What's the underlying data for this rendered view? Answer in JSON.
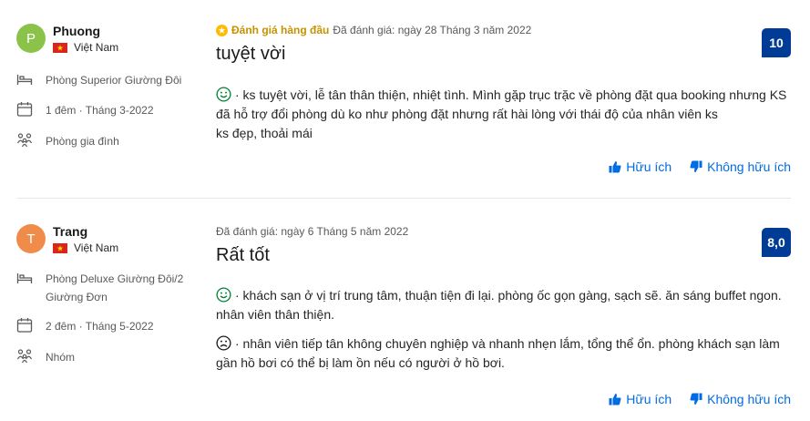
{
  "colors": {
    "brand_blue": "#003b95",
    "link_blue": "#006ce4",
    "top_badge": "#c69200",
    "happy_face": "#008234",
    "sad_face": "#1a1a1a",
    "avatar_phuong": "#8bc34a",
    "avatar_trang": "#f08c4a"
  },
  "reviews": [
    {
      "avatar_letter": "P",
      "name": "Phuong",
      "country": "Việt Nam",
      "room": "Phòng Superior Giường Đôi",
      "stay": "1 đêm · Tháng 3-2022",
      "traveler_type": "Phòng gia đình",
      "top_badge": "Đánh giá hàng đầu",
      "reviewed_date": "Đã đánh giá: ngày 28 Tháng 3 năm 2022",
      "title": "tuyệt vời",
      "score": "10",
      "positive_lines": [
        "· ks tuyệt vời, lễ tân thân thiện, nhiệt tình. Mình gặp trục trặc về phòng đặt qua booking nhưng KS",
        "đã hỗ trợ đổi phòng dù ko như phòng đặt nhưng rất hài lòng với thái độ của nhân viên ks",
        "ks đẹp, thoải mái"
      ],
      "helpful_label": "Hữu ích",
      "not_helpful_label": "Không hữu ích"
    },
    {
      "avatar_letter": "T",
      "name": "Trang",
      "country": "Việt Nam",
      "room_lines": [
        "Phòng Deluxe Giường Đôi/2",
        "Giường Đơn"
      ],
      "stay": "2 đêm · Tháng 5-2022",
      "traveler_type": "Nhóm",
      "reviewed_date": "Đã đánh giá: ngày 6 Tháng 5 năm 2022",
      "title": "Rất tốt",
      "score": "8,0",
      "positive_lines": [
        "· khách sạn ở vị trí trung tâm, thuận tiện đi lại. phòng ốc gọn gàng, sạch sẽ. ăn sáng buffet ngon.",
        "nhân viên thân thiện."
      ],
      "negative_lines": [
        "· nhân viên tiếp tân không chuyên nghiệp và nhanh nhẹn lắm, tổng thể ổn. phòng khách sạn làm",
        "gần hồ bơi có thể bị làm ồn nếu có người ở hồ bơi."
      ],
      "helpful_label": "Hữu ích",
      "not_helpful_label": "Không hữu ích"
    }
  ]
}
